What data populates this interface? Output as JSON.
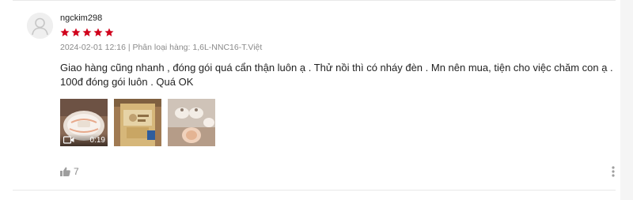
{
  "review": {
    "username": "ngckim298",
    "rating": 5,
    "meta": "2024-02-01 12:16 | Phân loại hàng: 1,6L-NNC16-T.Việt",
    "text": "Giao hàng cũng nhanh , đóng gói quá cẩn thận luôn ạ . Thử nồi thì có nháy đèn . Mn nên mua, tiện cho việc chăm con ạ . 100đ đóng gói luôn . Quá OK",
    "video_duration": "0:19",
    "like_count": "7"
  },
  "colors": {
    "star": "#d0011b",
    "meta_text": "#8a8a8a",
    "divider": "#e8e8e8"
  },
  "icons": {
    "avatar": "default-user-avatar",
    "star": "filled-star-icon",
    "video": "video-camera-icon",
    "like": "thumbs-up-icon",
    "more": "vertical-ellipsis-icon"
  }
}
